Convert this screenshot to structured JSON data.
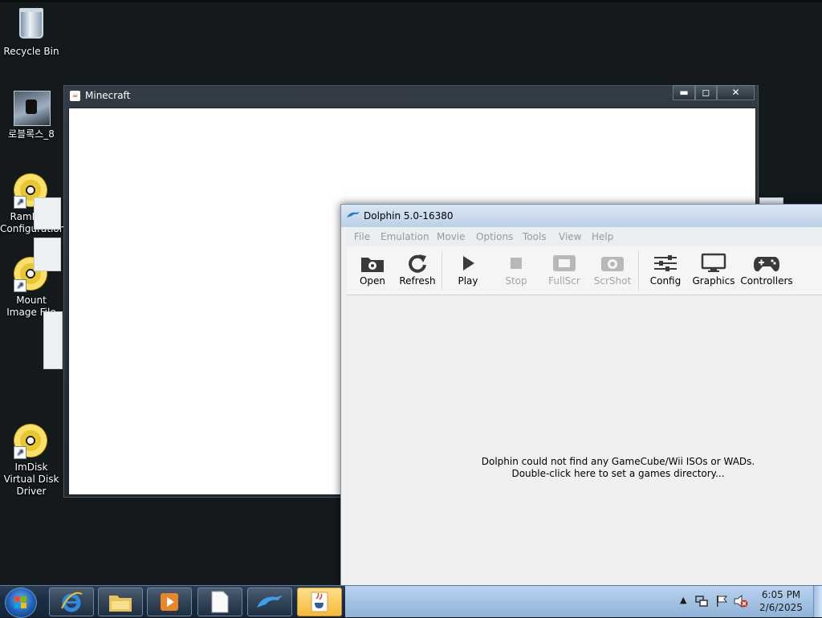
{
  "desktop": {
    "icons": [
      {
        "label": "Recycle Bin",
        "icon": "recycle-bin-icon"
      },
      {
        "label": "로블록스_8",
        "icon": "roblox-icon"
      },
      {
        "label": "RamDisk Configuration",
        "icon": "disc-icon"
      },
      {
        "label": "Mount Image File",
        "icon": "disc-icon"
      },
      {
        "label": "ImDisk Virtual Disk Driver",
        "icon": "disc-icon"
      }
    ]
  },
  "minecraft": {
    "title": "Minecraft",
    "controls": {
      "minimize": "▬",
      "maximize": "◻",
      "close": "✕"
    }
  },
  "dolphin": {
    "title": "Dolphin 5.0-16380",
    "menu": [
      "File",
      "Emulation",
      "Movie",
      "Options",
      "Tools",
      "View",
      "Help"
    ],
    "toolbar": [
      {
        "label": "Open",
        "enabled": true
      },
      {
        "label": "Refresh",
        "enabled": true
      },
      {
        "label": "Play",
        "enabled": true
      },
      {
        "label": "Stop",
        "enabled": false
      },
      {
        "label": "FullScr",
        "enabled": false
      },
      {
        "label": "ScrShot",
        "enabled": false
      },
      {
        "label": "Config",
        "enabled": true
      },
      {
        "label": "Graphics",
        "enabled": true
      },
      {
        "label": "Controllers",
        "enabled": true
      }
    ],
    "message": {
      "line1": "Dolphin could not find any GameCube/Wii ISOs or WADs.",
      "line2": "Double-click here to set a games directory..."
    }
  },
  "taskbar": {
    "pinned": [
      "internet-explorer-icon",
      "file-explorer-icon",
      "media-player-icon",
      "blank-document-icon",
      "dolphin-icon",
      "java-icon"
    ],
    "tray": {
      "time": "6:05 PM",
      "date": "2/6/2025"
    }
  },
  "colors": {
    "desktop": "#14191c",
    "dolphin_title": "#bcd1e6",
    "taskbar": "#1b2d42"
  }
}
